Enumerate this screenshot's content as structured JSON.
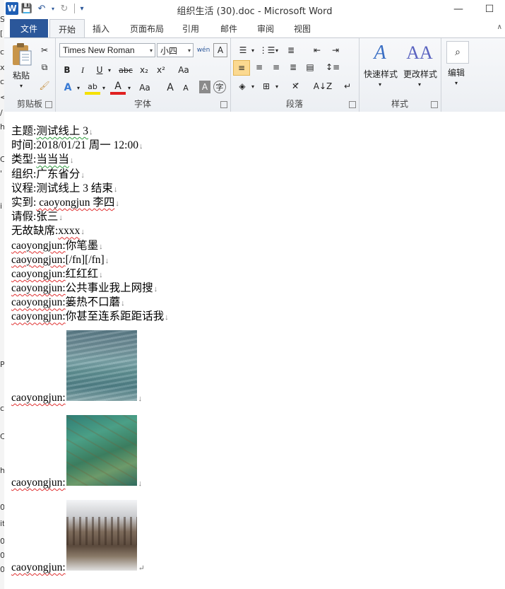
{
  "window": {
    "title": "组织生活 (30).doc - Microsoft Word",
    "minimize": "—",
    "maximize": "☐"
  },
  "qat": {
    "word": "W",
    "save": "💾",
    "undo": "↶",
    "redo": "↻",
    "customize": "▾"
  },
  "tabs": {
    "file": "文件",
    "items": [
      "开始",
      "插入",
      "页面布局",
      "引用",
      "邮件",
      "审阅",
      "视图"
    ],
    "active": "开始"
  },
  "ribbon": {
    "clipboard": {
      "label": "剪贴板",
      "paste": "粘贴"
    },
    "font": {
      "label": "字体",
      "font_name": "Times New Roman",
      "font_size": "小四",
      "bold": "B",
      "italic": "I",
      "underline": "U",
      "strike": "abc",
      "subscript": "x₂",
      "superscript": "x²",
      "grow": "A",
      "shrink": "A",
      "case": "Aa",
      "clear": "A",
      "char_border": "A",
      "circle": "字",
      "phonetic": "wén"
    },
    "paragraph": {
      "label": "段落"
    },
    "styles": {
      "label": "样式",
      "quick_styles": "快速样式",
      "change_styles": "更改样式"
    },
    "editing": {
      "label": "编辑",
      "find": "编辑"
    }
  },
  "document": {
    "lines": [
      {
        "prefix": "主题:",
        "text": "测试线上 3"
      },
      {
        "prefix": "时间:",
        "text": "2018/01/21  周一  12:00"
      },
      {
        "prefix": "类型:",
        "text": "当当当"
      },
      {
        "prefix": "组织:",
        "text": "广东省分"
      },
      {
        "prefix": "议程:",
        "text": "测试线上 3 结束"
      },
      {
        "prefix": "实到:",
        "text": " caoyongjun  李四"
      },
      {
        "prefix": "请假:",
        "text": "张三"
      },
      {
        "prefix": "无故缺席:",
        "text": "xxxx"
      },
      {
        "prefix": "caoyongjun:",
        "text": "你笔墨"
      },
      {
        "prefix": "caoyongjun:",
        "text": "[/fn][/fn]"
      },
      {
        "prefix": "caoyongjun:",
        "text": "红红红"
      },
      {
        "prefix": "caoyongjun:",
        "text": "公共事业我上网搜"
      },
      {
        "prefix": "caoyongjun:",
        "text": "篓热不口蘑"
      },
      {
        "prefix": "caoyongjun:",
        "text": "你甚至连系距距话我"
      }
    ],
    "image_lines": [
      {
        "prefix": "caoyongjun:",
        "mark": "↓"
      },
      {
        "prefix": "caoyongjun:",
        "mark": "↓"
      },
      {
        "prefix": "caoyongjun:",
        "mark": "↵"
      }
    ],
    "paragraph_mark": "↓"
  },
  "left_strip": [
    "S",
    "[",
    "c",
    "x",
    "c",
    "<",
    "/",
    "h",
    "C",
    "'",
    "i",
    "P",
    "c",
    "C",
    "h",
    "0",
    "it",
    "0",
    "0",
    "0"
  ]
}
